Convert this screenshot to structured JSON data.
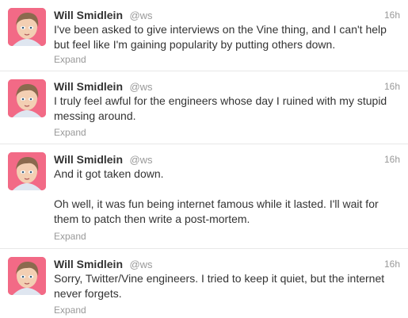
{
  "tweets": [
    {
      "name": "Will Smidlein",
      "handle": "@ws",
      "time": "16h",
      "text": "I've been asked to give interviews on the Vine thing, and I can't help\nbut feel like I'm gaining popularity by putting others down.",
      "expand": "Expand"
    },
    {
      "name": "Will Smidlein",
      "handle": "@ws",
      "time": "16h",
      "text": "I truly feel awful for the engineers whose day I ruined with my stupid\nmessing around.",
      "expand": "Expand"
    },
    {
      "name": "Will Smidlein",
      "handle": "@ws",
      "time": "16h",
      "text": "And it got taken down.\n\nOh well, it was fun being internet famous while it lasted. I'll wait for\nthem to patch then write a post-mortem.",
      "expand": "Expand"
    },
    {
      "name": "Will Smidlein",
      "handle": "@ws",
      "time": "16h",
      "text": "Sorry, Twitter/Vine engineers. I tried to keep it quiet, but the internet\nnever forgets.",
      "expand": "Expand"
    }
  ],
  "colors": {
    "avatar_bg": "#f26a86",
    "muted": "#999999",
    "text": "#333333"
  },
  "icons": [
    "avatar-illustration"
  ]
}
